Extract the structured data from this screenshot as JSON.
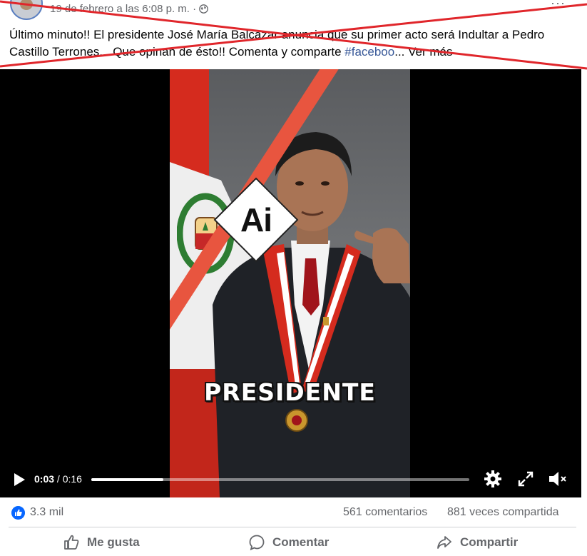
{
  "post": {
    "timestamp": "19 de febrero a las 6:08 p. m. ·",
    "text_main": "Último minuto!! El presidente José María Balcázar anuncia que su primer acto será Indultar a Pedro Castillo Terrones... Que opinan de ésto!! Comenta y comparte ",
    "hashtag": "#faceboo",
    "see_more": "... Ver más",
    "more_menu": "···"
  },
  "video": {
    "ai_badge": "Ai",
    "caption": "PRESIDENTE",
    "current_time": "0:03",
    "separator": " / ",
    "duration": "0:16",
    "progress": 0.19
  },
  "stats": {
    "likes": "3.3 mil",
    "comments": "561 comentarios",
    "shares": "881 veces compartida"
  },
  "actions": {
    "like": "Me gusta",
    "comment": "Comentar",
    "share": "Compartir"
  },
  "colors": {
    "strike": "#e0262b",
    "link": "#385898",
    "muted": "#65676b",
    "like_blue": "#0866ff"
  }
}
